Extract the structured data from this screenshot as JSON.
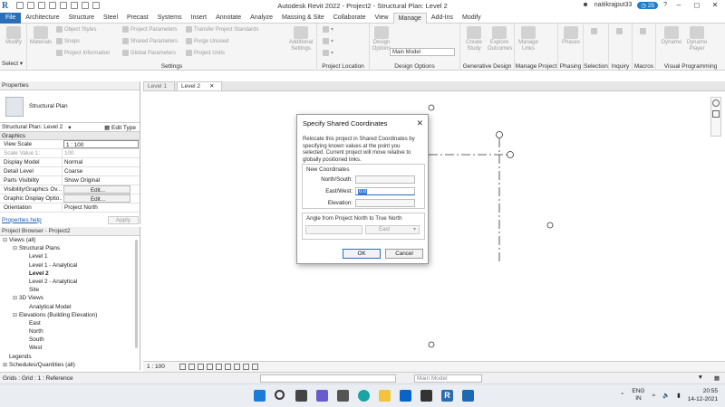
{
  "titlebar": {
    "title": "Autodesk Revit 2022 - Project2 - Structural Plan: Level 2",
    "user": "naitikrajput33",
    "clock_badge": "25"
  },
  "ribbon_tabs": [
    "File",
    "Architecture",
    "Structure",
    "Steel",
    "Precast",
    "Systems",
    "Insert",
    "Annotate",
    "Analyze",
    "Massing & Site",
    "Collaborate",
    "View",
    "Manage",
    "Add-Ins",
    "Modify"
  ],
  "active_tab": "Manage",
  "ribbon": {
    "select_label": "Select",
    "modify_label": "Modify",
    "materials_label": "Materials",
    "settings_items": [
      "Object Styles",
      "Snaps",
      "Project Information",
      "Project Parameters",
      "Shared Parameters",
      "Global Parameters",
      "Transfer Project Standards",
      "Purge Unused",
      "Project Units"
    ],
    "additional_settings": "Additional Settings",
    "groups": {
      "settings": "Settings",
      "project_location": "Project Location",
      "design_options": "Design Options",
      "generative_design": "Generative Design",
      "manage_project": "Manage Project",
      "phasing": "Phasing",
      "selection": "Selection",
      "inquiry": "Inquiry",
      "macros": "Macros",
      "visual_programming": "Visual Programming"
    },
    "design_options_btn": "Design Options",
    "main_model_value": "Main Model",
    "create_study": "Create Study",
    "explore_outcomes": "Explore Outcomes",
    "manage_links": "Manage Links",
    "phases": "Phases",
    "dynamo": "Dynamo",
    "dynamo_player": "Dynamo Player"
  },
  "properties": {
    "header": "Properties",
    "type_name": "Structural Plan",
    "instance_select": "Structural Plan: Level 2",
    "edit_type": "Edit Type",
    "group": "Graphics",
    "rows": [
      {
        "k": "View Scale",
        "v": "1 : 100"
      },
      {
        "k": "Scale Value    1:",
        "v": "100"
      },
      {
        "k": "Display Model",
        "v": "Normal"
      },
      {
        "k": "Detail Level",
        "v": "Coarse"
      },
      {
        "k": "Parts Visibility",
        "v": "Show Original"
      },
      {
        "k": "Visibility/Graphics Ov...",
        "v": "Edit..."
      },
      {
        "k": "Graphic Display Optio...",
        "v": "Edit..."
      },
      {
        "k": "Orientation",
        "v": "Project North"
      }
    ],
    "help_link": "Properties help",
    "apply": "Apply"
  },
  "browser": {
    "header": "Project Browser - Project2",
    "items": [
      {
        "label": "Views (all)",
        "indent": 0,
        "toggle": "−"
      },
      {
        "label": "Structural Plans",
        "indent": 1,
        "toggle": "−"
      },
      {
        "label": "Level 1",
        "indent": 2,
        "toggle": ""
      },
      {
        "label": "Level 1 - Analytical",
        "indent": 2,
        "toggle": ""
      },
      {
        "label": "Level 2",
        "indent": 2,
        "toggle": "",
        "bold": true
      },
      {
        "label": "Level 2 - Analytical",
        "indent": 2,
        "toggle": ""
      },
      {
        "label": "Site",
        "indent": 2,
        "toggle": ""
      },
      {
        "label": "3D Views",
        "indent": 1,
        "toggle": "−"
      },
      {
        "label": "Analytical Model",
        "indent": 2,
        "toggle": ""
      },
      {
        "label": "Elevations (Building Elevation)",
        "indent": 1,
        "toggle": "−"
      },
      {
        "label": "East",
        "indent": 2,
        "toggle": ""
      },
      {
        "label": "North",
        "indent": 2,
        "toggle": ""
      },
      {
        "label": "South",
        "indent": 2,
        "toggle": ""
      },
      {
        "label": "West",
        "indent": 2,
        "toggle": ""
      },
      {
        "label": "Legends",
        "indent": 0,
        "toggle": ""
      },
      {
        "label": "Schedules/Quantities (all)",
        "indent": 0,
        "toggle": "+"
      }
    ]
  },
  "view_tabs": [
    "Level 1",
    "Level 2"
  ],
  "view_control": {
    "scale": "1 : 100"
  },
  "status": {
    "message": "Grids : Grid : 1 : Reference",
    "model": "Main Model"
  },
  "dialog": {
    "title": "Specify Shared Coordinates",
    "description": "Relocate this project in Shared Coordinates by specifying known values at the point you selected. Current project will move relative to globally positioned links.",
    "new_coords_legend": "New Coordinates",
    "north_south_label": "North/South:",
    "east_west_label": "East/West:",
    "east_west_value": "0.0",
    "elevation_label": "Elevation:",
    "angle_legend": "Angle from Project North to True North",
    "angle_direction": "East",
    "ok": "OK",
    "cancel": "Cancel"
  },
  "taskbar": {
    "lang1": "ENG",
    "lang2": "IN",
    "time": "20:55",
    "date": "14-12-2021"
  }
}
